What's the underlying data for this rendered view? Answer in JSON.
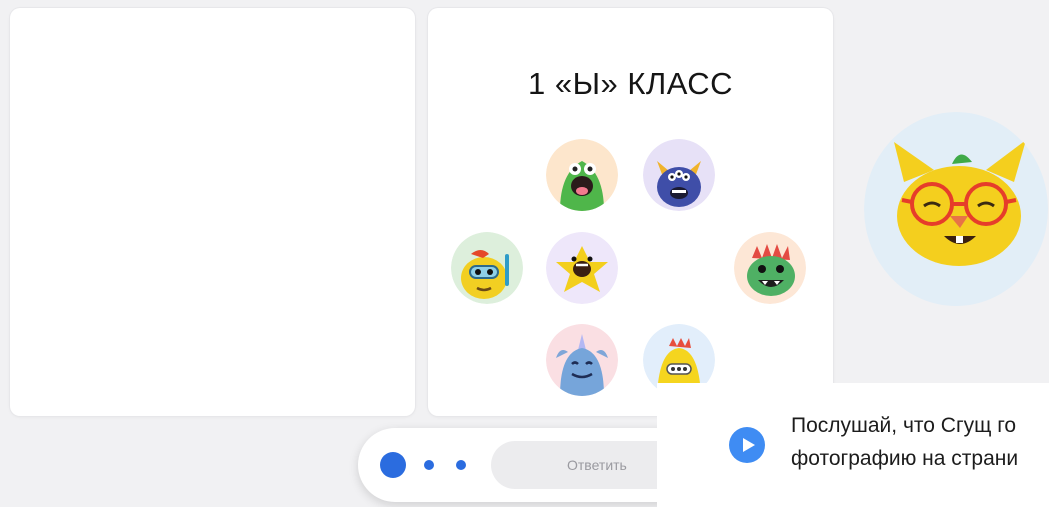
{
  "class_card": {
    "title": "1 «Ы» КЛАСС"
  },
  "answer_bar": {
    "reply_label": "Ответить"
  },
  "hint": {
    "line1": "Послушай, что Сгущ го",
    "line2": "фотографию на страни"
  },
  "colors": {
    "accent": "#2b6cdf",
    "play_button": "#3f8cf3",
    "card_bg": "#ffffff",
    "page_bg": "#f1f1f3"
  },
  "icons": [
    "play-icon"
  ],
  "avatars": [
    "green-monster-avatar",
    "blue-horned-monster-avatar",
    "yellow-diver-monster-avatar",
    "yellow-starfish-monster-avatar",
    "green-spiky-monster-avatar",
    "blue-unicorn-monster-avatar",
    "yellow-chick-monster-avatar",
    "yellow-cat-with-glasses-avatar"
  ]
}
